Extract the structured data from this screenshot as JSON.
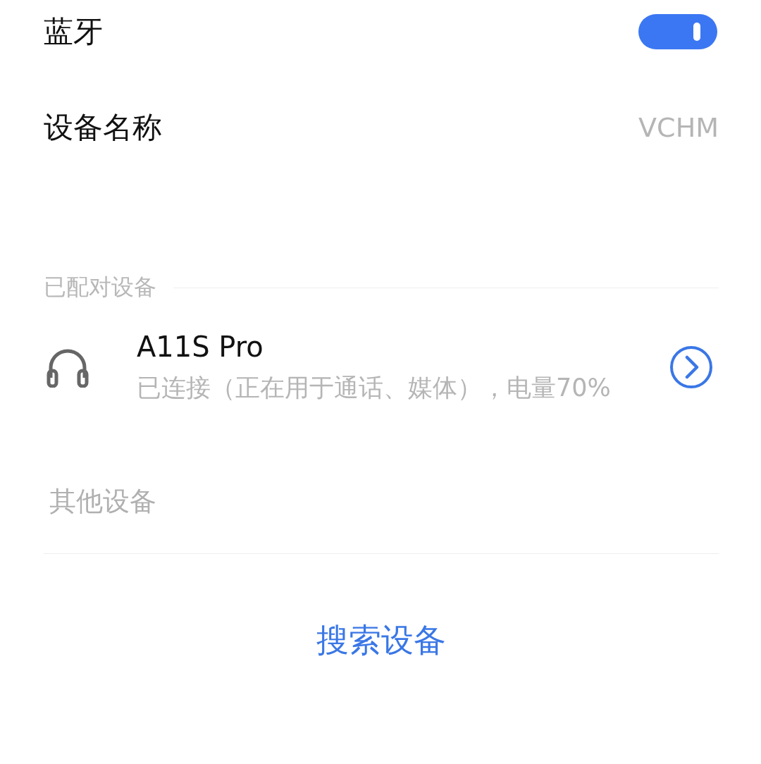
{
  "bluetooth": {
    "label": "蓝牙",
    "on": true
  },
  "device_name": {
    "label": "设备名称",
    "value": "VCHM"
  },
  "paired_section": {
    "title": "已配对设备",
    "devices": [
      {
        "name": "A11S Pro",
        "status": "已连接（正在用于通话、媒体），电量70%"
      }
    ]
  },
  "other_section": {
    "title": "其他设备"
  },
  "search_button": {
    "label": "搜索设备"
  }
}
